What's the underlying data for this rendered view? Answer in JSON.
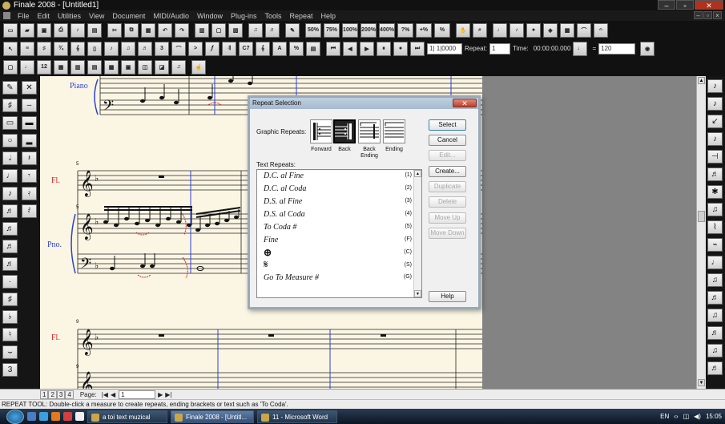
{
  "window": {
    "title": "Finale 2008 - [Untitled1]"
  },
  "menu": [
    "File",
    "Edit",
    "Utilities",
    "View",
    "Document",
    "MIDI/Audio",
    "Window",
    "Plug-ins",
    "Tools",
    "Repeat",
    "Help"
  ],
  "toolbar": {
    "zoom": [
      "50%",
      "75%",
      "100%",
      "200%",
      "400%",
      "?%",
      "+%",
      "%"
    ],
    "counter": "1| 1|0000",
    "repeat_label": "Repeat:",
    "repeat_value": "1",
    "time_label": "Time:",
    "time_value": "00:00:00.000",
    "tempo_eq": "=",
    "tempo_value": "120"
  },
  "score": {
    "staff_labels": [
      "Piano",
      "Fl.",
      "Pno.",
      "Fl."
    ],
    "measure_numbers": [
      "5",
      "5",
      "9",
      "9"
    ]
  },
  "dialog": {
    "title": "Repeat Selection",
    "graphic_label": "Graphic Repeats:",
    "graphic_repeats": [
      "Forward",
      "Back",
      "Back Ending",
      "Ending"
    ],
    "text_label": "Text Repeats:",
    "text_repeats": [
      {
        "text": "D.C. al Fine",
        "key": "(1)"
      },
      {
        "text": "D.C. al Coda",
        "key": "(2)"
      },
      {
        "text": "D.S. al Fine",
        "key": "(3)"
      },
      {
        "text": "D.S. al Coda",
        "key": "(4)"
      },
      {
        "text": "To Coda #",
        "key": "(5)"
      },
      {
        "text": "Fine",
        "key": "(F)"
      },
      {
        "text": "⊕",
        "key": "(C)"
      },
      {
        "text": "𝄋",
        "key": "(S)"
      },
      {
        "text": "Go To Measure #",
        "key": "(G)"
      }
    ],
    "buttons": {
      "select": "Select",
      "cancel": "Cancel",
      "edit": "Edit...",
      "create": "Create...",
      "duplicate": "Duplicate",
      "delete": "Delete",
      "move_up": "Move Up",
      "move_down": "Move Down",
      "help": "Help"
    }
  },
  "pagebar": {
    "page_label": "Page:",
    "page_value": "1",
    "tabs": [
      "1",
      "2",
      "3",
      "4"
    ]
  },
  "status": "REPEAT TOOL: Double-click a measure to create repeats, ending brackets or text such as 'To Coda'.",
  "taskbar": {
    "tasks": [
      "a toi text muzical",
      "Finale 2008 - [Untitl...",
      "11 - Microsoft Word"
    ],
    "lang": "EN",
    "time": "15:05"
  }
}
